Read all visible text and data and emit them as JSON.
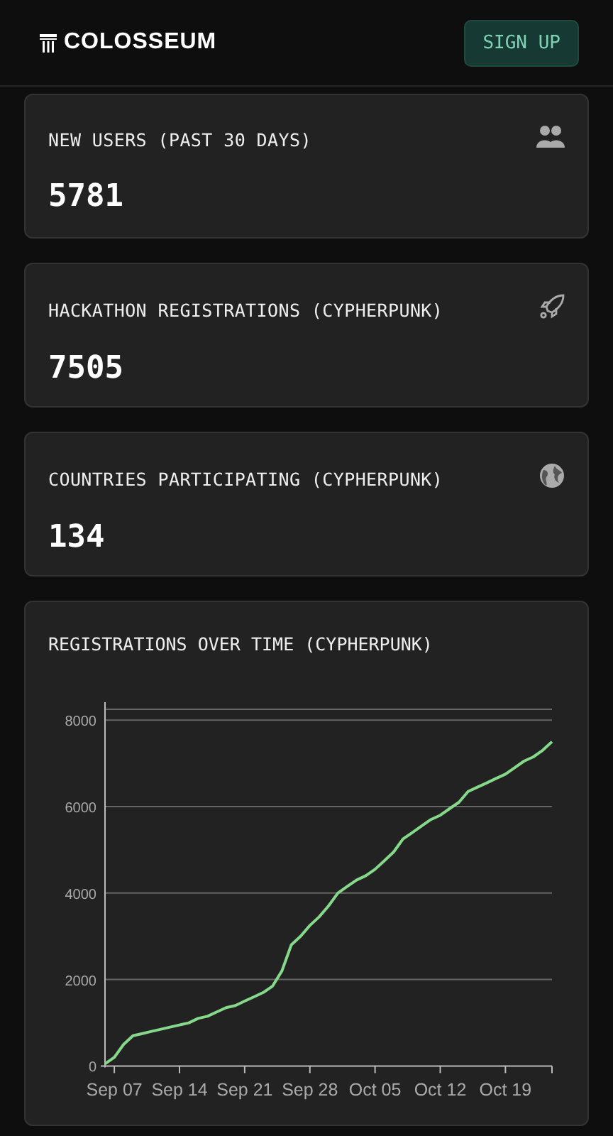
{
  "header": {
    "logo": "COLOSSEUM",
    "sign_up": "SIGN UP"
  },
  "stats": [
    {
      "label": "NEW USERS (PAST 30 DAYS)",
      "value": "5781",
      "kind": "users"
    },
    {
      "label": "HACKATHON REGISTRATIONS (CYPHERPUNK)",
      "value": "7505",
      "kind": "rocket"
    },
    {
      "label": "COUNTRIES PARTICIPATING (CYPHERPUNK)",
      "value": "134",
      "kind": "globe"
    }
  ],
  "chart_card": {
    "title": "REGISTRATIONS OVER TIME (CYPHERPUNK)",
    "chart_data": {
      "type": "line",
      "categories": [
        null,
        "Sep 07",
        null,
        null,
        null,
        null,
        null,
        null,
        "Sep 14",
        null,
        null,
        null,
        null,
        null,
        null,
        "Sep 21",
        null,
        null,
        null,
        null,
        null,
        null,
        "Sep 28",
        null,
        null,
        null,
        null,
        null,
        null,
        "Oct 05",
        null,
        null,
        null,
        null,
        null,
        null,
        "Oct 12",
        null,
        null,
        null,
        null,
        null,
        null,
        "Oct 19",
        null,
        null,
        null,
        null,
        null
      ],
      "series": [
        {
          "color": "#86d98a",
          "values": [
            50,
            200,
            500,
            700,
            750,
            800,
            850,
            900,
            950,
            1000,
            1100,
            1150,
            1250,
            1350,
            1400,
            1500,
            1600,
            1700,
            1850,
            2200,
            2800,
            3000,
            3250,
            3450,
            3700,
            4000,
            4150,
            4300,
            4400,
            4550,
            4750,
            4950,
            5250,
            5400,
            5550,
            5700,
            5800,
            5950,
            6100,
            6350,
            6450,
            6550,
            6650,
            6750,
            6900,
            7050,
            7150,
            7300,
            7500
          ]
        }
      ],
      "ylim": [
        0,
        8250
      ],
      "grid": true,
      "yticks": [
        0,
        2000,
        4000,
        6000,
        8000
      ]
    }
  }
}
